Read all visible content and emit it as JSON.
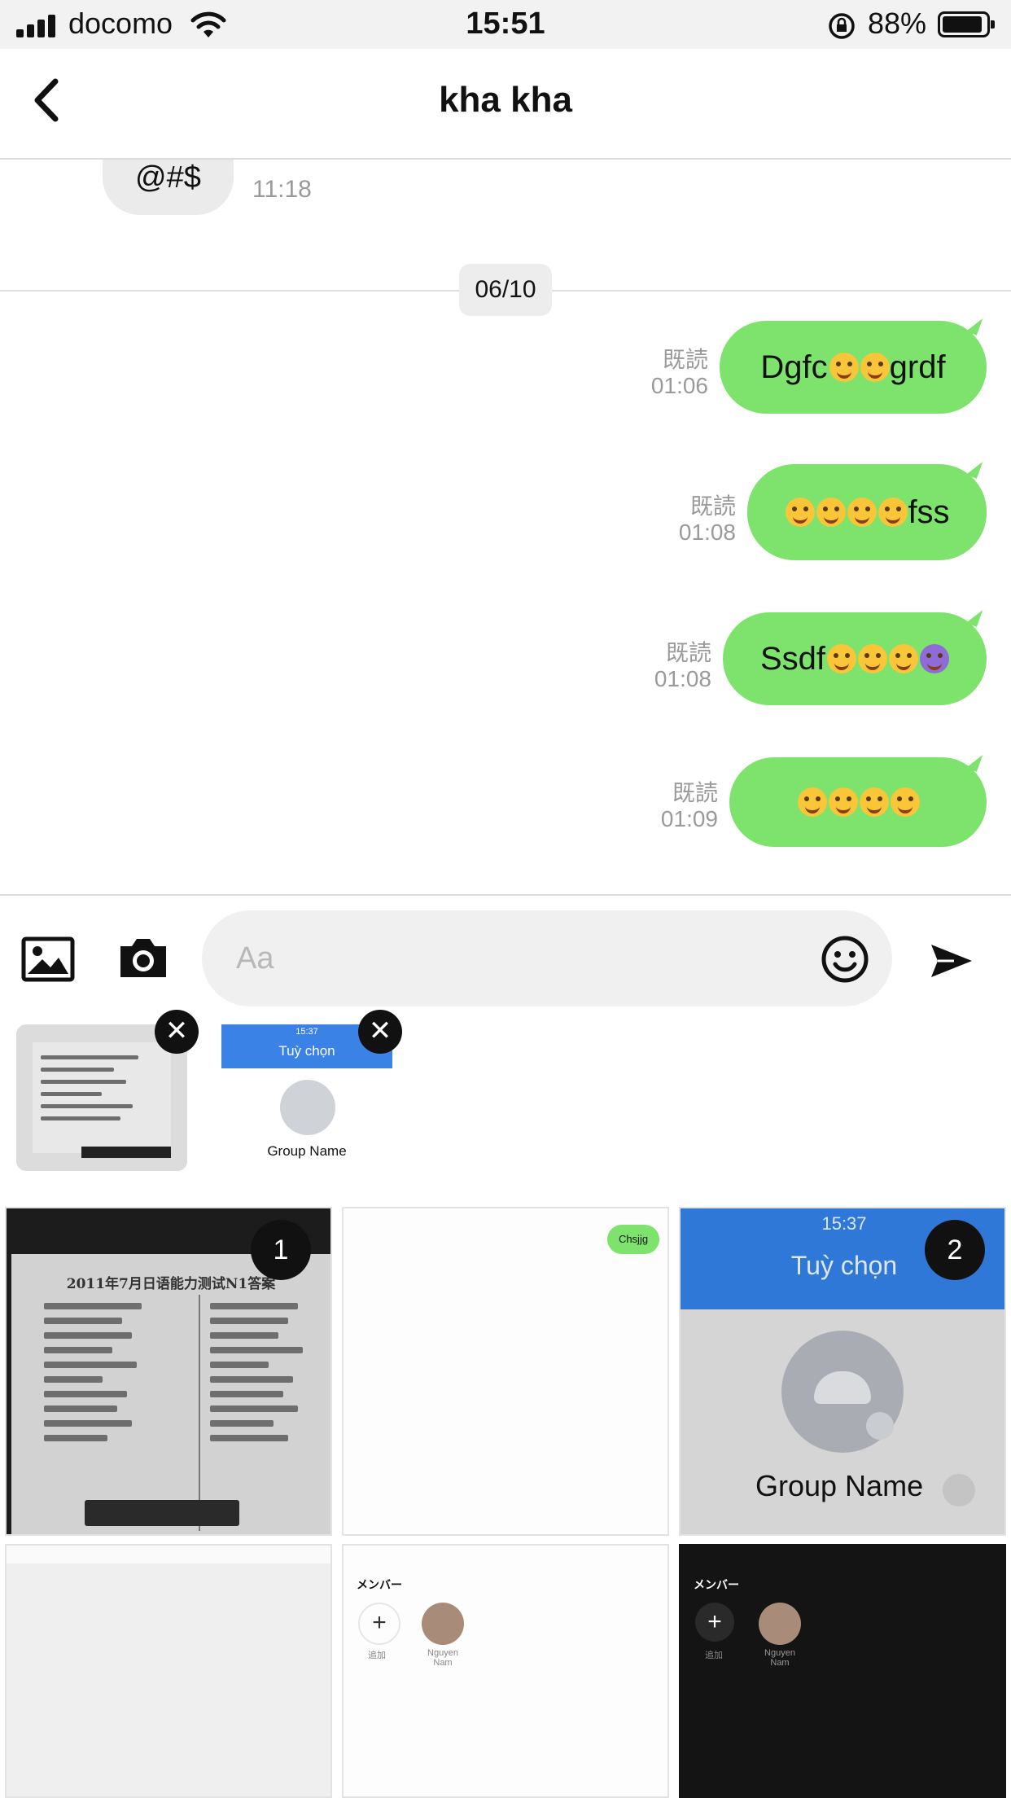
{
  "status_bar": {
    "carrier": "docomo",
    "time": "15:51",
    "battery": "88%"
  },
  "header": {
    "title": "kha kha"
  },
  "chat": {
    "incoming_text": "@#$",
    "incoming_time": "11:18",
    "date_separator": "06/10",
    "messages": [
      {
        "text": "Dgfc",
        "suffix": "grdf",
        "read": "既読",
        "time": "01:06"
      },
      {
        "text": "",
        "suffix": "fss",
        "read": "既読",
        "time": "01:08"
      },
      {
        "text": "Ssdf",
        "suffix": "",
        "read": "既読",
        "time": "01:08"
      },
      {
        "text": "",
        "suffix": "",
        "read": "既読",
        "time": "01:09"
      }
    ]
  },
  "composer": {
    "placeholder": "Aa"
  },
  "selected": {
    "preview2_time": "15:37",
    "preview2_header": "Tuỳ chọn",
    "preview2_group": "Group Name"
  },
  "gallery": {
    "badge1": "1",
    "badge2": "2",
    "bubble_text": "Chsjjg",
    "cell3_time": "15:37",
    "cell3_header": "Tuỳ chọn",
    "cell3_group": "Group Name",
    "members_label": "メンバー",
    "add_label": "追加",
    "member_name": "Nguyen Nam",
    "doc_title": "2011年7月日语能力测试N1答案"
  },
  "colors": {
    "outgoing_bubble": "#7ee36c",
    "accent_blue": "#3b82e6",
    "grey_bg": "#d5d5d5"
  },
  "icons": [
    "back-chevron-icon",
    "gallery-icon",
    "camera-icon",
    "emoji-icon",
    "send-icon",
    "close-icon",
    "wifi-icon",
    "signal-icon",
    "battery-icon",
    "rotation-lock-icon"
  ]
}
